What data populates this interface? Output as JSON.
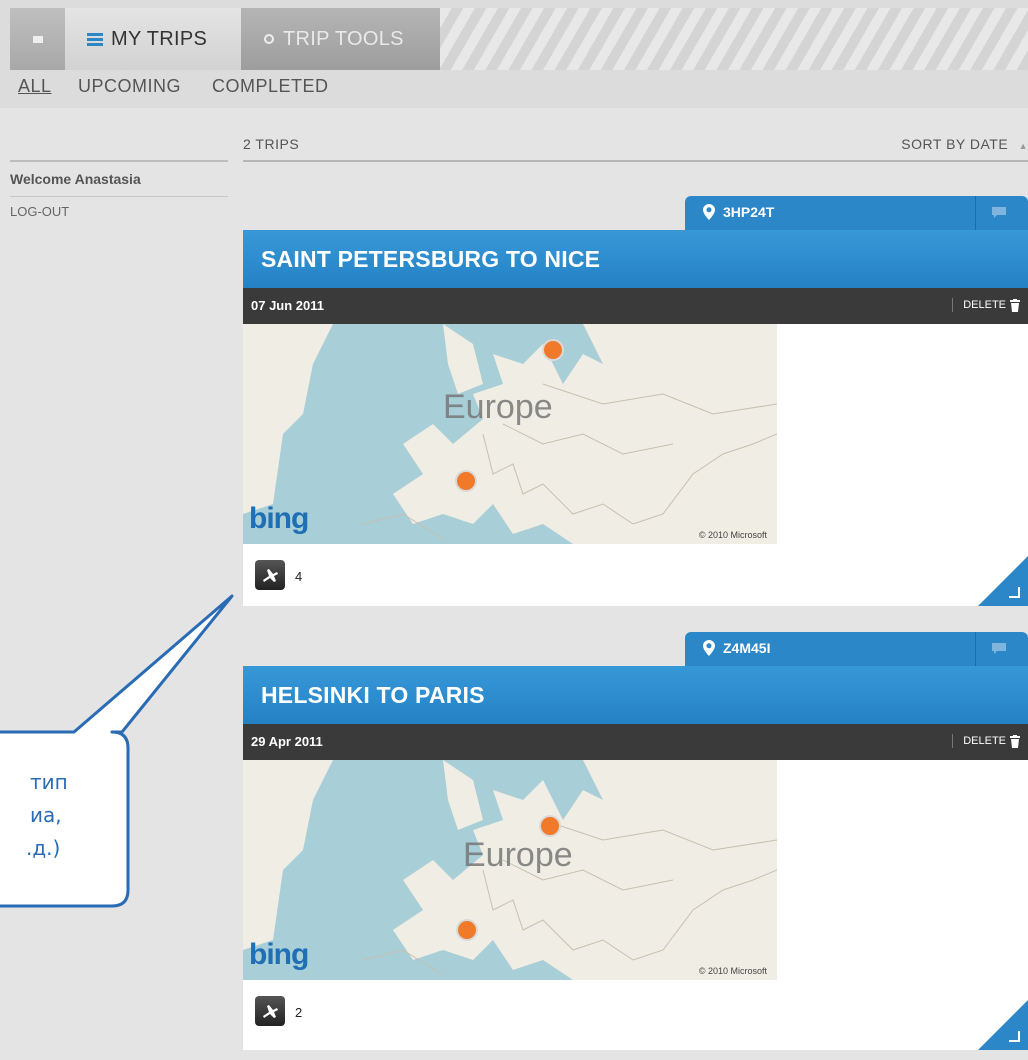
{
  "nav": {
    "tabs": [
      {
        "label": "",
        "icon": "home-icon"
      },
      {
        "label": "MY TRIPS",
        "icon": "list-icon"
      },
      {
        "label": "TRIP TOOLS",
        "icon": "gear-icon"
      }
    ],
    "subtabs": [
      "ALL",
      "UPCOMING",
      "COMPLETED"
    ],
    "active_subtab": "ALL"
  },
  "sidebar": {
    "welcome": "Welcome Anastasia",
    "logout": "LOG-OUT"
  },
  "list": {
    "count_label": "2 TRIPS",
    "sort_label": "SORT BY DATE"
  },
  "trips": [
    {
      "code": "3HP24T",
      "title": "SAINT PETERSBURG TO NICE",
      "date": "07 Jun 2011",
      "delete_label": "DELETE",
      "map_label": "Europe",
      "map_logo": "bing",
      "map_copyright": "© 2010 Microsoft",
      "flights": "4"
    },
    {
      "code": "Z4M45I",
      "title": "HELSINKI TO PARIS",
      "date": "29 Apr 2011",
      "delete_label": "DELETE",
      "map_label": "Europe",
      "map_logo": "bing",
      "map_copyright": "© 2010 Microsoft",
      "flights": "2"
    }
  ],
  "callout": {
    "lines": [
      "тип",
      "иа,",
      ".д.)"
    ]
  },
  "colors": {
    "accent": "#2b87c8",
    "date_bar": "#3a3a3a",
    "callout": "#2a6bb5",
    "pin": "#f07a2a"
  }
}
